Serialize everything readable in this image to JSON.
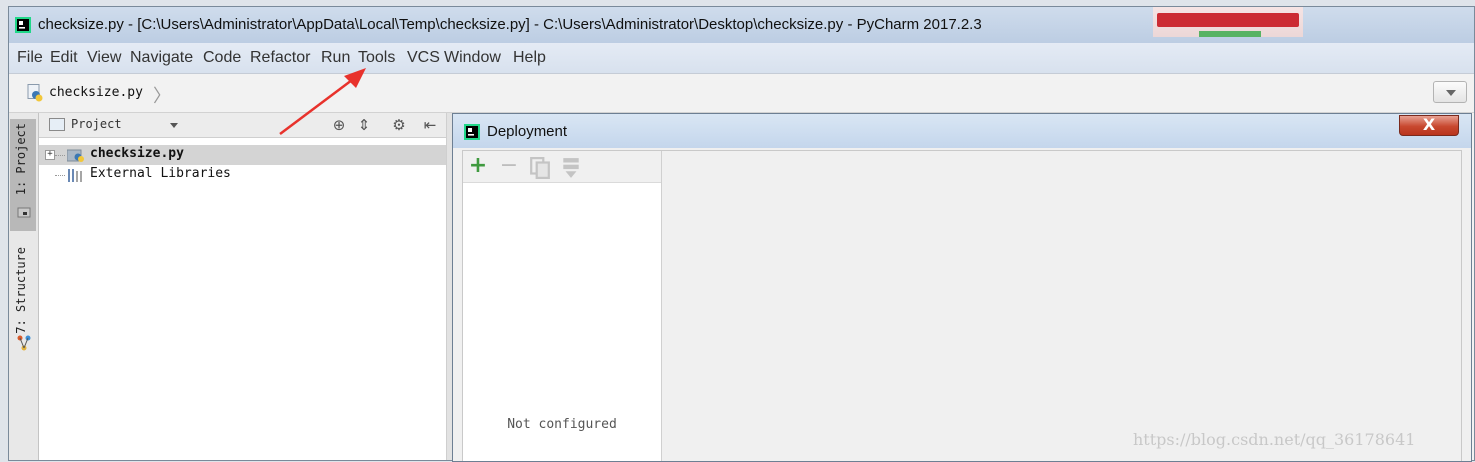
{
  "window": {
    "title": "checksize.py - [C:\\Users\\Administrator\\AppData\\Local\\Temp\\checksize.py] - C:\\Users\\Administrator\\Desktop\\checksize.py - PyCharm 2017.2.3"
  },
  "menu": {
    "items": [
      {
        "label": "File"
      },
      {
        "label": "Edit"
      },
      {
        "label": "View"
      },
      {
        "label": "Navigate"
      },
      {
        "label": "Code"
      },
      {
        "label": "Refactor"
      },
      {
        "label": "Run"
      },
      {
        "label": "Tools"
      },
      {
        "label": "VCS"
      },
      {
        "label": "Window"
      },
      {
        "label": "Help"
      }
    ]
  },
  "navbar": {
    "breadcrumb": "checksize.py"
  },
  "side_tabs": {
    "project": "1: Project",
    "structure": "7: Structure"
  },
  "project_panel": {
    "title": "Project",
    "tree": [
      {
        "label": "checksize.py",
        "bold": true,
        "selected": true
      },
      {
        "label": "External Libraries",
        "bold": false,
        "selected": false
      }
    ]
  },
  "deployment_dialog": {
    "title": "Deployment",
    "close_label": "X",
    "empty_text": "Not configured",
    "toolbar": [
      "add-icon",
      "remove-icon",
      "copy-icon",
      "use-as-default-icon"
    ]
  },
  "watermark": "https://blog.csdn.net/qq_36178641",
  "colors": {
    "add_green": "#3f9a3f",
    "close_red": "#c8482f",
    "annotation_arrow": "#e8322c"
  }
}
